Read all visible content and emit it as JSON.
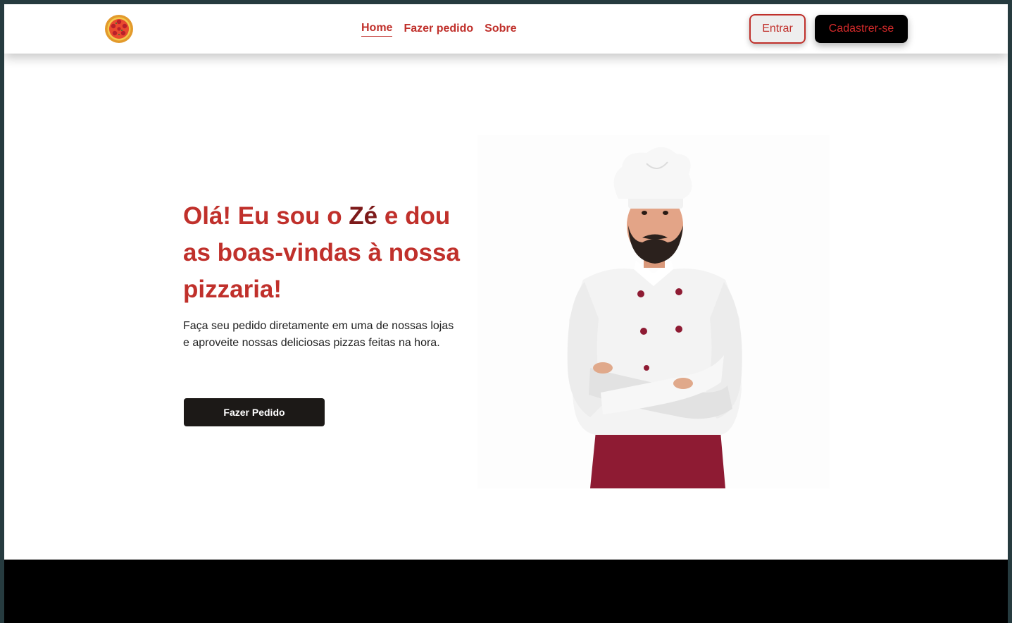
{
  "header": {
    "logo_icon": "pizza-icon",
    "nav": [
      {
        "label": "Home",
        "active": true
      },
      {
        "label": "Fazer pedido",
        "active": false
      },
      {
        "label": "Sobre",
        "active": false
      }
    ],
    "login_label": "Entrar",
    "signup_label": "Cadastrer-se"
  },
  "hero": {
    "title_part1": "Olá! Eu sou o ",
    "title_name": "Zé",
    "title_part2": " e dou as boas-vindas à nossa pizzaria!",
    "description": "Faça seu pedido diretamente em uma de nossas lojas e aproveite nossas deliciosas pizzas feitas na hora.",
    "cta_label": "Fazer Pedido",
    "image_icon": "chef-illustration"
  },
  "colors": {
    "accent": "#c0302b",
    "accent_dark": "#7d1a1a",
    "cta_bg": "#1c1917",
    "footer_bg": "#000000"
  }
}
